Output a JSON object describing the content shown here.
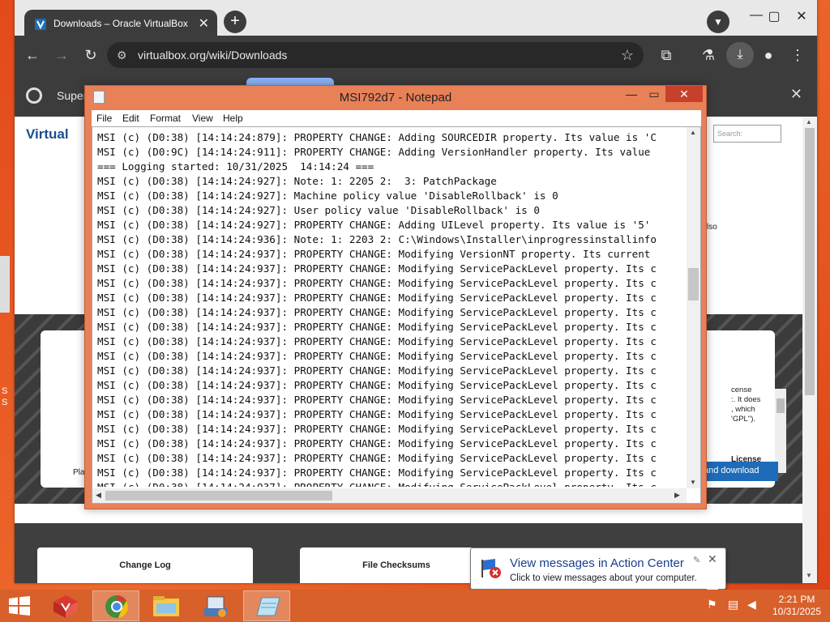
{
  "browser": {
    "tab_title": "Downloads – Oracle VirtualBox",
    "new_tab": "+",
    "url": "virtualbox.org/wiki/Downloads",
    "bookmark_label": "Super",
    "page": {
      "logo_text": "Virtual",
      "search_placeholder": "Search:",
      "also_fragment": "lso",
      "license_text": "cense\n:. It does\n, which\n'GPL\").",
      "license_heading": "License",
      "agree_button": "and download",
      "platform_fragment": "Pla",
      "sections": [
        "Change Log",
        "File Checksums"
      ],
      "desktop_fragment": "S\nS"
    }
  },
  "notepad": {
    "title": "MSI792d7 - Notepad",
    "menu": [
      "File",
      "Edit",
      "Format",
      "View",
      "Help"
    ],
    "lines": [
      "MSI (c) (D0:38) [14:14:24:879]: PROPERTY CHANGE: Adding SOURCEDIR property. Its value is 'C",
      "MSI (c) (D0:9C) [14:14:24:911]: PROPERTY CHANGE: Adding VersionHandler property. Its value",
      "=== Logging started: 10/31/2025  14:14:24 ===",
      "MSI (c) (D0:38) [14:14:24:927]: Note: 1: 2205 2:  3: PatchPackage",
      "MSI (c) (D0:38) [14:14:24:927]: Machine policy value 'DisableRollback' is 0",
      "MSI (c) (D0:38) [14:14:24:927]: User policy value 'DisableRollback' is 0",
      "MSI (c) (D0:38) [14:14:24:927]: PROPERTY CHANGE: Adding UILevel property. Its value is '5'",
      "MSI (c) (D0:38) [14:14:24:936]: Note: 1: 2203 2: C:\\Windows\\Installer\\inprogressinstallinfo",
      "MSI (c) (D0:38) [14:14:24:937]: PROPERTY CHANGE: Modifying VersionNT property. Its current",
      "MSI (c) (D0:38) [14:14:24:937]: PROPERTY CHANGE: Modifying ServicePackLevel property. Its c",
      "MSI (c) (D0:38) [14:14:24:937]: PROPERTY CHANGE: Modifying ServicePackLevel property. Its c",
      "MSI (c) (D0:38) [14:14:24:937]: PROPERTY CHANGE: Modifying ServicePackLevel property. Its c",
      "MSI (c) (D0:38) [14:14:24:937]: PROPERTY CHANGE: Modifying ServicePackLevel property. Its c",
      "MSI (c) (D0:38) [14:14:24:937]: PROPERTY CHANGE: Modifying ServicePackLevel property. Its c",
      "MSI (c) (D0:38) [14:14:24:937]: PROPERTY CHANGE: Modifying ServicePackLevel property. Its c",
      "MSI (c) (D0:38) [14:14:24:937]: PROPERTY CHANGE: Modifying ServicePackLevel property. Its c",
      "MSI (c) (D0:38) [14:14:24:937]: PROPERTY CHANGE: Modifying ServicePackLevel property. Its c",
      "MSI (c) (D0:38) [14:14:24:937]: PROPERTY CHANGE: Modifying ServicePackLevel property. Its c",
      "MSI (c) (D0:38) [14:14:24:937]: PROPERTY CHANGE: Modifying ServicePackLevel property. Its c",
      "MSI (c) (D0:38) [14:14:24:937]: PROPERTY CHANGE: Modifying ServicePackLevel property. Its c",
      "MSI (c) (D0:38) [14:14:24:937]: PROPERTY CHANGE: Modifying ServicePackLevel property. Its c",
      "MSI (c) (D0:38) [14:14:24:937]: PROPERTY CHANGE: Modifying ServicePackLevel property. Its c",
      "MSI (c) (D0:38) [14:14:24:937]: PROPERTY CHANGE: Modifying ServicePackLevel property. Its c",
      "MSI (c) (D0:38) [14:14:24:937]: PROPERTY CHANGE: Modifying ServicePackLevel property. Its c",
      "MSI (c) (D0:38) [14:14:24:937]: PROPERTY CHANGE: Modifying ServicePackLevel property. Its c"
    ]
  },
  "notification": {
    "title": "View messages in Action Center",
    "body": "Click to view messages about your computer."
  },
  "taskbar": {
    "apps": [
      {
        "name": "virtualbox-installer-icon",
        "active": false
      },
      {
        "name": "chrome-icon",
        "active": true
      },
      {
        "name": "file-explorer-icon",
        "active": false
      },
      {
        "name": "setup-icon",
        "active": false
      },
      {
        "name": "notepad-icon",
        "active": true
      }
    ],
    "time": "2:21 PM",
    "date": "10/31/2025"
  },
  "colors": {
    "desktop": "#e9521e",
    "taskbar": "#d8602a",
    "notepad_frame": "#e88058",
    "close_button": "#c7402b",
    "chrome_dark": "#3c3c3c"
  }
}
